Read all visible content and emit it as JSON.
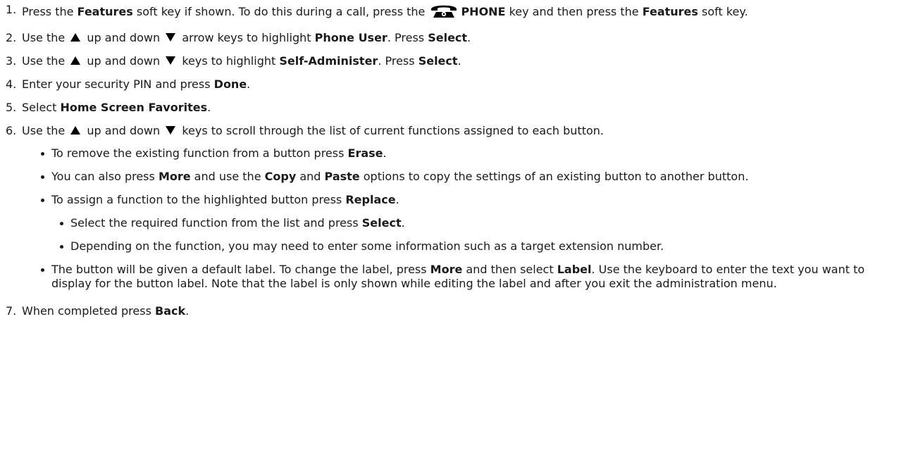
{
  "steps": [
    {
      "num": "1.",
      "t1": "Press the ",
      "b1": "Features",
      "t2": " soft key if shown. To do this during a call, press the ",
      "icon": "phone-icon",
      "b2": "PHONE",
      "t3": " key and then press the ",
      "b3": "Features",
      "t4": " soft key."
    },
    {
      "num": "2.",
      "t1": "Use the ",
      "t2": " up and down ",
      "t3": " arrow keys to highlight ",
      "b1": "Phone User",
      "t4": ". Press ",
      "b2": "Select",
      "t5": "."
    },
    {
      "num": "3.",
      "t1": "Use the ",
      "t2": " up and down ",
      "t3": " keys to highlight ",
      "b1": "Self-Administer",
      "t4": ". Press ",
      "b2": "Select",
      "t5": "."
    },
    {
      "num": "4.",
      "t1": "Enter your security PIN and press ",
      "b1": "Done",
      "t2": "."
    },
    {
      "num": "5.",
      "t1": "Select ",
      "b1": "Home Screen Favorites",
      "t2": "."
    },
    {
      "num": "6.",
      "t1": "Use the ",
      "t2": " up and down ",
      "t3": " keys to scroll through the list of current functions assigned to each button.",
      "bullets": {
        "erase": {
          "t1": "To remove the existing function from a button press ",
          "b1": "Erase",
          "t2": "."
        },
        "copy": {
          "t1": "You can also press ",
          "b1": "More",
          "t2": " and use the ",
          "b2": "Copy",
          "t3": " and ",
          "b3": "Paste",
          "t4": " options to copy the settings of an existing button to another button."
        },
        "replace": {
          "t1": "To assign a function to the highlighted button press ",
          "b1": "Replace",
          "t2": ".",
          "sub": {
            "select": {
              "t1": "Select the required function from the list and press ",
              "b1": "Select",
              "t2": "."
            },
            "depending": {
              "t1": "Depending on the function, you may need to enter some information such as a target extension number."
            }
          }
        },
        "label": {
          "t1": "The button will be given a default label. To change the label, press ",
          "b1": "More",
          "t2": " and then select ",
          "b2": "Label",
          "t3": ". Use the keyboard to enter the text you want to display for the button label. Note that the label is only shown while editing the label and after you exit the administration menu."
        }
      }
    },
    {
      "num": "7.",
      "t1": "When completed press ",
      "b1": "Back",
      "t2": "."
    }
  ],
  "icons": {
    "up": "arrow-up-icon",
    "down": "arrow-down-icon",
    "phone": "phone-icon"
  }
}
